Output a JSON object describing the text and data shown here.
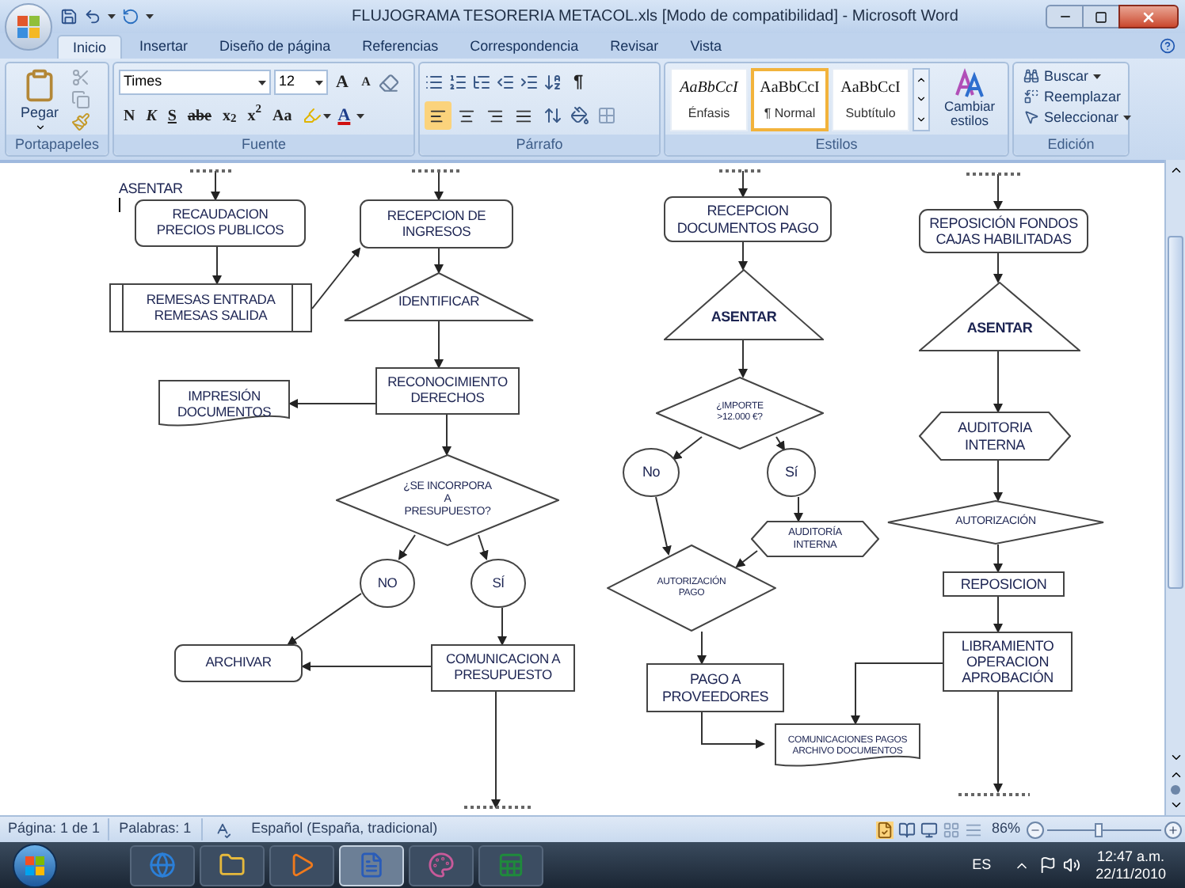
{
  "window": {
    "title": "FLUJOGRAMA TESORERIA METACOL.xls [Modo de compatibilidad] - Microsoft Word"
  },
  "tabs": [
    {
      "label": "Inicio",
      "selected": true
    },
    {
      "label": "Insertar",
      "selected": false
    },
    {
      "label": "Diseño de página",
      "selected": false
    },
    {
      "label": "Referencias",
      "selected": false
    },
    {
      "label": "Correspondencia",
      "selected": false
    },
    {
      "label": "Revisar",
      "selected": false
    },
    {
      "label": "Vista",
      "selected": false
    }
  ],
  "clipboard": {
    "paste": "Pegar",
    "group": "Portapapeles"
  },
  "font": {
    "name": "Times",
    "size": "12",
    "grow": "A",
    "shrink": "A",
    "format_buttons": [
      "N",
      "K",
      "S",
      "abe",
      "x$_{2}$",
      "x$^{2}$",
      "Aa"
    ],
    "color_button": "A",
    "group": "Fuente"
  },
  "paragraph": {
    "align_buttons": [
      {
        "kind": "left",
        "selected": true
      },
      {
        "kind": "center",
        "selected": false
      },
      {
        "kind": "right",
        "selected": false
      },
      {
        "kind": "justify",
        "selected": false
      }
    ],
    "pilcrow": "¶",
    "group": "Párrafo"
  },
  "styles": {
    "items": [
      {
        "sample": "AaBbCcI",
        "name": "Énfasis",
        "italic": true,
        "selected": false
      },
      {
        "sample": "AaBbCcI",
        "name": "¶ Normal",
        "italic": false,
        "selected": true
      },
      {
        "sample": "AaBbCcI",
        "name": "Subtítulo",
        "italic": false,
        "selected": false
      }
    ],
    "change": "Cambiar estilos",
    "group": "Estilos"
  },
  "editing": {
    "items": [
      {
        "kind": "find",
        "label": "Buscar"
      },
      {
        "kind": "replace",
        "label": "Reemplazar"
      },
      {
        "kind": "select",
        "label": "Seleccionar"
      }
    ],
    "group": "Edición"
  },
  "flowchart": {
    "nodes": [
      {
        "kind": "label",
        "text": "ASENTAR",
        "bold": false
      },
      {
        "kind": "rounded",
        "text": "RECAUDACION\nPRECIOS PUBLICOS",
        "bold": false
      },
      {
        "kind": "bars",
        "text": "REMESAS ENTRADA\nREMESAS SALIDA",
        "bold": false
      },
      {
        "kind": "rounded",
        "text": "RECEPCION DE\nINGRESOS",
        "bold": false
      },
      {
        "kind": "triangle",
        "text": "IDENTIFICAR",
        "bold": false
      },
      {
        "kind": "rect",
        "text": "RECONOCIMIENTO\nDERECHOS",
        "bold": false
      },
      {
        "kind": "document",
        "text": "IMPRESIÓN\nDOCUMENTOS",
        "bold": false
      },
      {
        "kind": "diamond",
        "text": "¿SE INCORPORA\nA\nPRESUPUESTO?",
        "bold": false
      },
      {
        "kind": "circle",
        "text": "NO",
        "bold": false
      },
      {
        "kind": "circle",
        "text": "SÍ",
        "bold": false
      },
      {
        "kind": "rounded",
        "text": "ARCHIVAR",
        "bold": false
      },
      {
        "kind": "rect",
        "text": "COMUNICACION A\nPRESUPUESTO",
        "bold": false
      },
      {
        "kind": "rounded",
        "text": "RECEPCION\nDOCUMENTOS PAGO",
        "bold": false
      },
      {
        "kind": "triangle",
        "text": "ASENTAR",
        "bold": true
      },
      {
        "kind": "diamond",
        "text": "¿IMPORTE\n>12.000 €?",
        "bold": false
      },
      {
        "kind": "circle",
        "text": "No",
        "bold": false
      },
      {
        "kind": "circle",
        "text": "Sí",
        "bold": false
      },
      {
        "kind": "hexagon",
        "text": "AUDITORÍA\nINTERNA",
        "bold": false
      },
      {
        "kind": "diamond",
        "text": "AUTORIZACIÓN\nPAGO",
        "bold": false
      },
      {
        "kind": "rect",
        "text": "PAGO A\nPROVEEDORES",
        "bold": false
      },
      {
        "kind": "document",
        "text": "COMUNICACIONES PAGOS\nARCHIVO DOCUMENTOS",
        "bold": false
      },
      {
        "kind": "rounded",
        "text": "REPOSICIÓN FONDOS\nCAJAS HABILITADAS",
        "bold": false
      },
      {
        "kind": "triangle",
        "text": "ASENTAR",
        "bold": true
      },
      {
        "kind": "hexagon",
        "text": "AUDITORIA\nINTERNA",
        "bold": false
      },
      {
        "kind": "diamond",
        "text": "AUTORIZACIÓN",
        "bold": false
      },
      {
        "kind": "rect",
        "text": "REPOSICION",
        "bold": false
      },
      {
        "kind": "rect",
        "text": "LIBRAMIENTO\nOPERACION\nAPROBACIÓN",
        "bold": false
      }
    ]
  },
  "status_bar": {
    "page": "Página: 1 de 1",
    "words": "Palabras: 1",
    "language": "Español (España, tradicional)",
    "zoom": "86%",
    "zoom_slider": {
      "level": 0.45
    }
  },
  "taskbar": {
    "apps": [
      {
        "kind": "browser",
        "selected": false
      },
      {
        "kind": "folder",
        "selected": false
      },
      {
        "kind": "media",
        "selected": false
      },
      {
        "kind": "word",
        "selected": true
      },
      {
        "kind": "paint",
        "selected": false
      },
      {
        "kind": "excel",
        "selected": false
      }
    ],
    "language": "ES",
    "time": "12:47 a.m.",
    "date": "22/11/2010"
  }
}
